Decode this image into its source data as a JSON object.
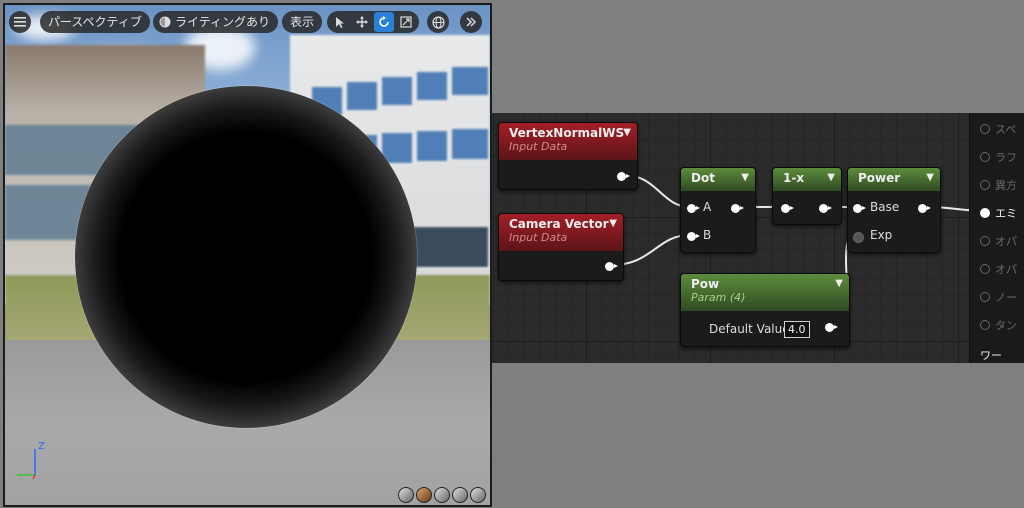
{
  "viewport": {
    "toolbar": {
      "view_mode": "パースペクティブ",
      "lighting": "ライティングあり",
      "show": "表示"
    },
    "axis_label": "Z"
  },
  "graph": {
    "nodes": {
      "vertex_normal": {
        "title": "VertexNormalWS",
        "subtitle": "Input Data"
      },
      "camera_vector": {
        "title": "Camera Vector",
        "subtitle": "Input Data"
      },
      "dot": {
        "title": "Dot",
        "pin_a": "A",
        "pin_b": "B"
      },
      "one_minus": {
        "title": "1-x"
      },
      "power": {
        "title": "Power",
        "pin_base": "Base",
        "pin_exp": "Exp"
      },
      "pow": {
        "title": "Pow",
        "subtitle": "Param (4)",
        "default_label": "Default Value",
        "default_value": "4.0"
      }
    },
    "material_panel": {
      "rows": [
        "スペ",
        "ラフ",
        "異方",
        "エミ",
        "オパ",
        "オパ",
        "ノー",
        "タン",
        "ワー"
      ],
      "active_row": "エミ"
    }
  },
  "colors": {
    "input_header": "#a41f27",
    "param_header": "#5d8c3c",
    "toolbar_active": "#2a7fd6"
  }
}
